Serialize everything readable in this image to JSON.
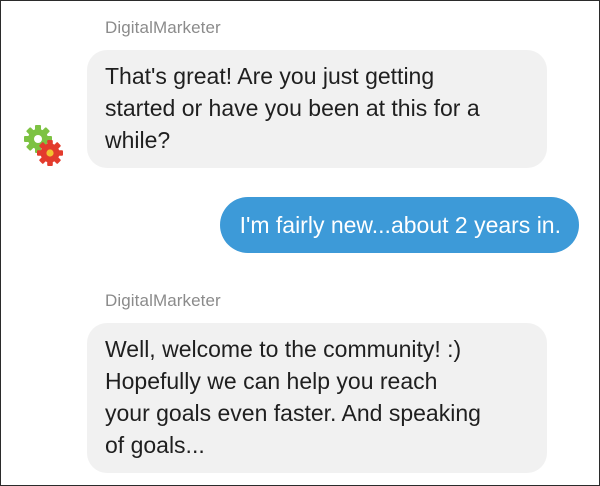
{
  "conversation": {
    "messages": [
      {
        "sender": "DigitalMarketer",
        "direction": "incoming",
        "text": "That's great! Are you just getting\nstarted or have you been at this for a\nwhile?"
      },
      {
        "direction": "outgoing",
        "text": "I'm fairly new...about 2 years in."
      },
      {
        "sender": "DigitalMarketer",
        "direction": "incoming",
        "text": "Well, welcome to the community! :)\nHopefully we can help you reach\nyour goals even faster. And speaking\nof goals..."
      }
    ]
  },
  "avatar": {
    "icon": "gears-icon",
    "colors": [
      "#7dc243",
      "#e33b2d",
      "#f2c230"
    ]
  },
  "colors": {
    "incoming_bubble": "#f1f1f1",
    "outgoing_bubble": "#3d9ad8",
    "sender_name": "#8b8b8b"
  }
}
